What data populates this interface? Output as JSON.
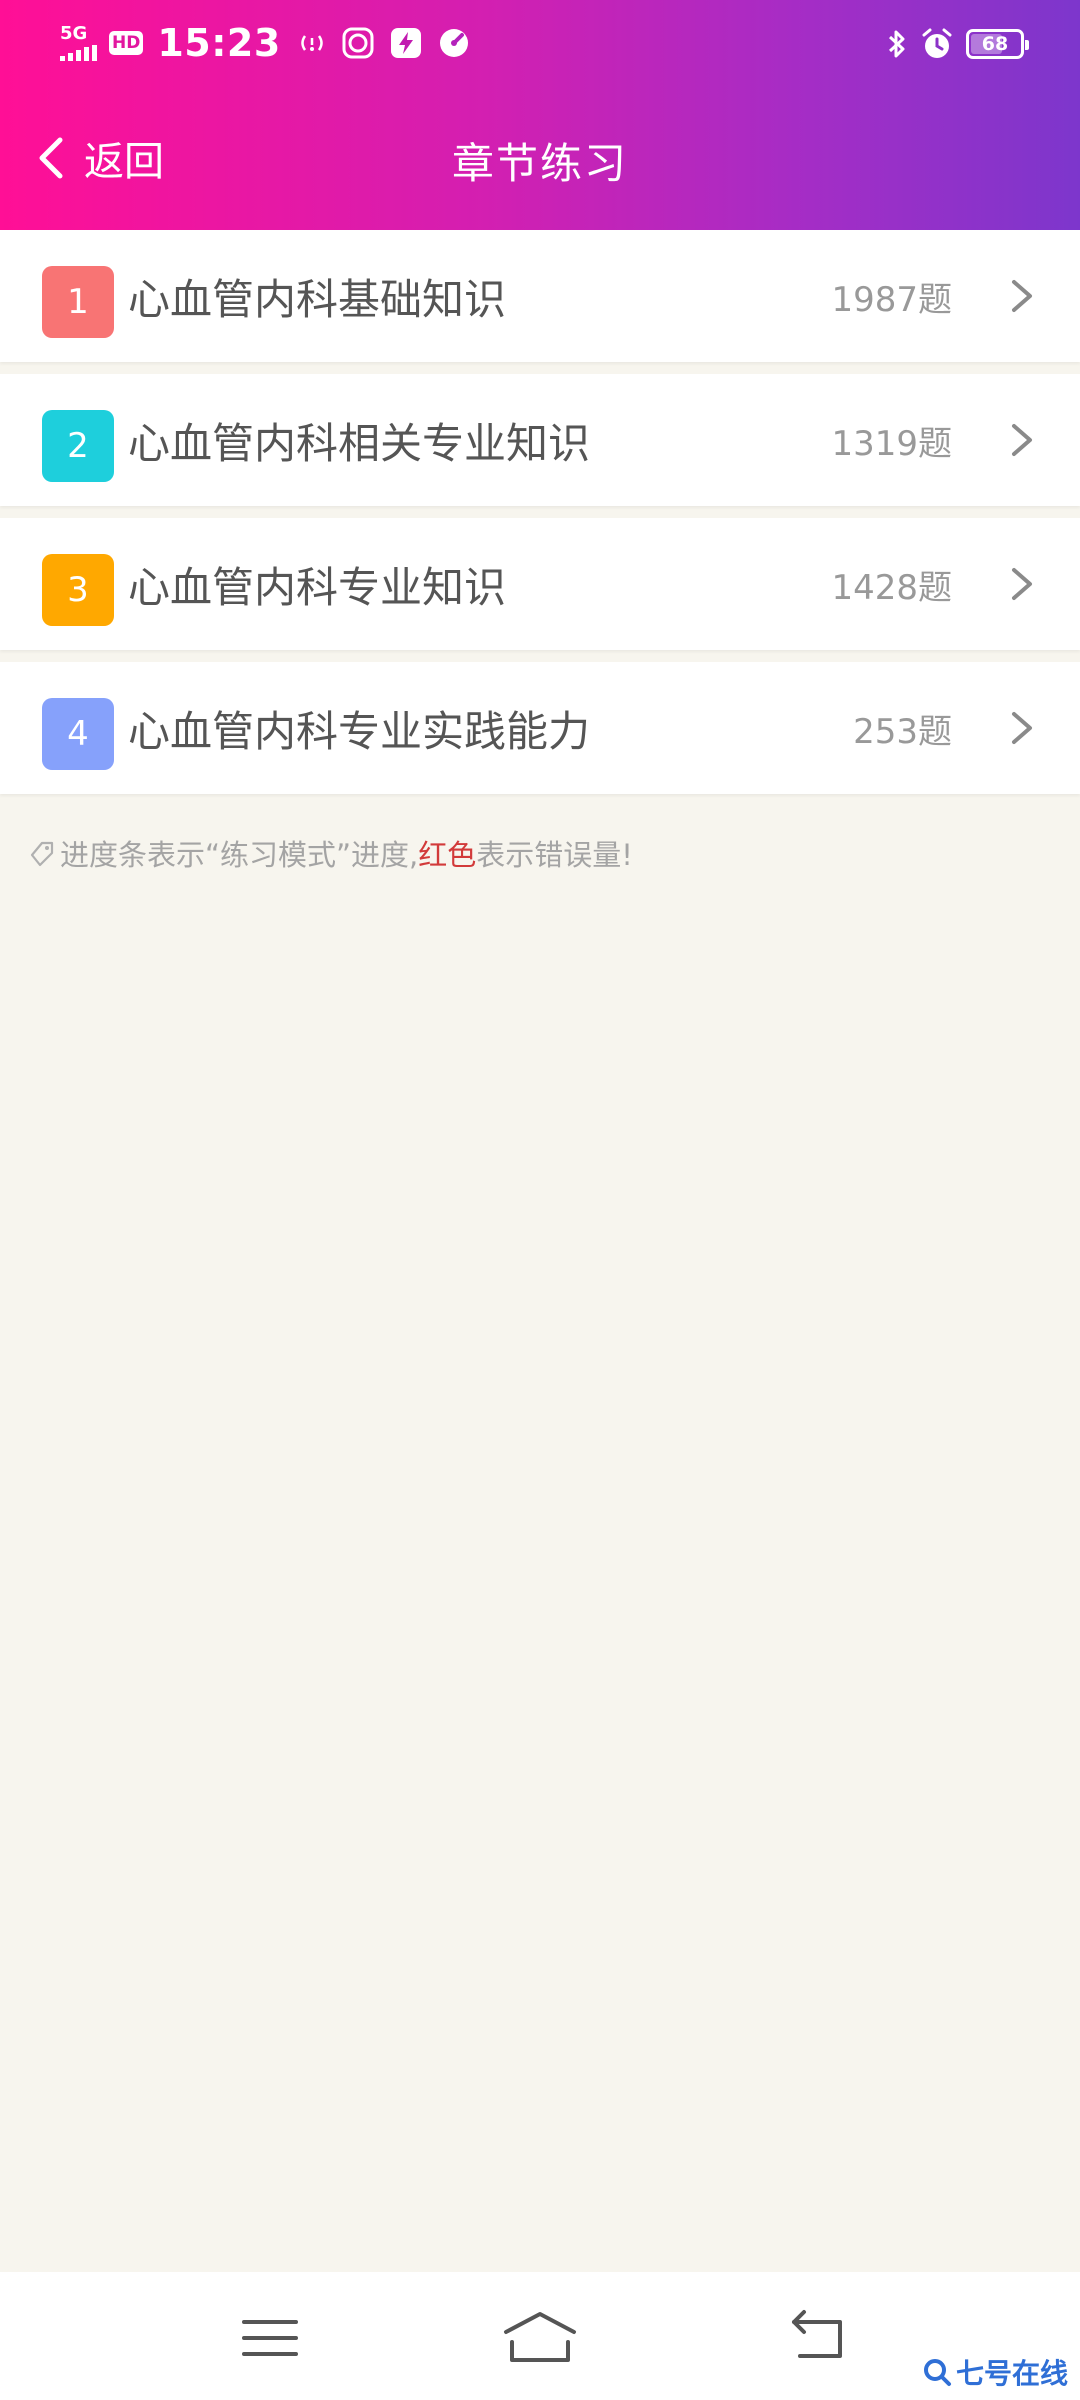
{
  "status_bar": {
    "network": "5G",
    "hd_badge": "HD",
    "time": "15:23",
    "battery_level": "68",
    "battery_fraction": 0.68,
    "icons": [
      "signal-icon",
      "wifi-calling-icon",
      "face-icon",
      "flash-icon",
      "speed-icon",
      "bluetooth-icon",
      "alarm-icon"
    ]
  },
  "nav": {
    "back_label": "返回",
    "title": "章节练习"
  },
  "chapters": [
    {
      "number": "1",
      "title": "心血管内科基础知识",
      "count": "1987题",
      "color": "#f87474"
    },
    {
      "number": "2",
      "title": "心血管内科相关专业知识",
      "count": "1319题",
      "color": "#1ecfdc"
    },
    {
      "number": "3",
      "title": "心血管内科专业知识",
      "count": "1428题",
      "color": "#ffa800"
    },
    {
      "number": "4",
      "title": "心血管内科专业实践能力",
      "count": "253题",
      "color": "#86a1fb"
    }
  ],
  "hint": {
    "before": "进度条表示“练习模式”进度,",
    "red": "红色",
    "after": "表示错误量!"
  },
  "watermark": "七号在线",
  "colors": {
    "header_start": "#ff0f96",
    "header_end": "#7d36cc",
    "page_bg": "#f7f5ee",
    "hint_red": "#d23a3a"
  }
}
